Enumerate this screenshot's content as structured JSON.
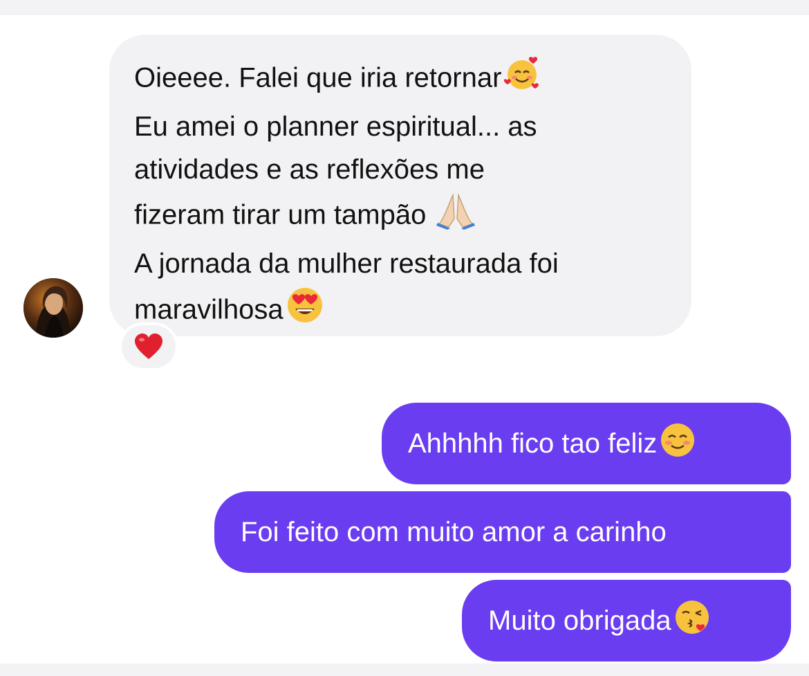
{
  "conversation": {
    "incoming": {
      "lines": [
        "Oieeee. Falei que iria retornar",
        "Eu amei o planner espiritual... as",
        "atividades e as reflexões me",
        "fizeram tirar um tampão",
        "A jornada da mulher restaurada foi",
        "maravilhosa"
      ],
      "emojis": [
        "smiling-face-with-hearts",
        "folded-hands",
        "heart-eyes-face"
      ],
      "reaction": "red-heart"
    },
    "outgoing": [
      {
        "text": "Ahhhhh fico tao feliz",
        "emoji": "smiling-blushing-face"
      },
      {
        "text": "Foi feito com muito amor a carinho"
      },
      {
        "text": "Muito obrigada",
        "emoji": "face-blowing-kiss"
      }
    ]
  },
  "colors": {
    "incoming_bubble": "#f2f2f4",
    "outgoing_bubble": "#6b3df0",
    "outgoing_text": "#ffffff",
    "incoming_text": "#111111"
  }
}
